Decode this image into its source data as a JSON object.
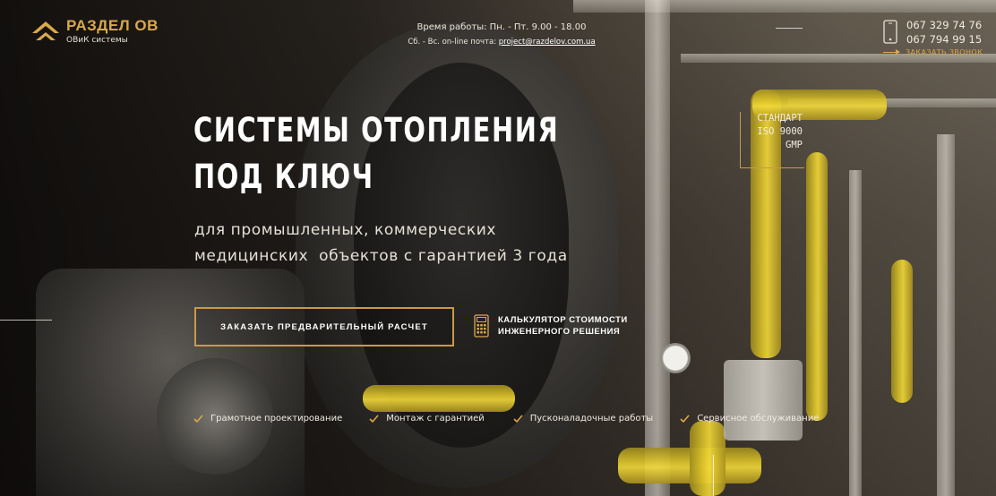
{
  "logo": {
    "title": "РАЗДЕЛ ОВ",
    "subtitle": "ОВиК системы"
  },
  "work_hours": {
    "weekday": "Время работы: Пн. - Пт. 9.00 - 18.00",
    "weekend_prefix": "Сб. - Вс. on-line почта:",
    "email": "project@razdelov.com.ua"
  },
  "contacts": {
    "phone_1": "067 329 74 76",
    "phone_2": "067 794 99 15",
    "callback_label": "ЗАКАЗАТЬ ЗВОНОК"
  },
  "hero": {
    "title_line_1": "СИСТЕМЫ ОТОПЛЕНИЯ",
    "title_line_2": "ПОД КЛЮЧ",
    "subtitle_line_1": "для промышленных, коммерческих",
    "subtitle_line_2": "медицинских  объектов с гарантией 3 года"
  },
  "standards": {
    "line_1": "СТАНДАРТ",
    "line_2": "ISO 9000",
    "line_3": "GMP"
  },
  "cta": {
    "order_label": "ЗАКАЗАТЬ ПРЕДВАРИТЕЛЬНЫЙ РАСЧЕТ",
    "calculator_line_1": "КАЛЬКУЛЯТОР СТОИМОСТИ",
    "calculator_line_2": "ИНЖЕНЕРНОГО РЕШЕНИЯ"
  },
  "features": [
    "Грамотное проектирование",
    "Монтаж с гарантией",
    "Пусконаладочные работы",
    "Сервисное обслуживание"
  ],
  "colors": {
    "accent": "#d9a94a",
    "border_accent": "#c99a45",
    "text": "#ffffff"
  },
  "icons": {
    "logo": "logo-mark-icon",
    "phone": "smartphone-icon",
    "callback": "arrow-right-icon",
    "calculator": "calculator-icon",
    "feature": "checkmark-icon"
  }
}
